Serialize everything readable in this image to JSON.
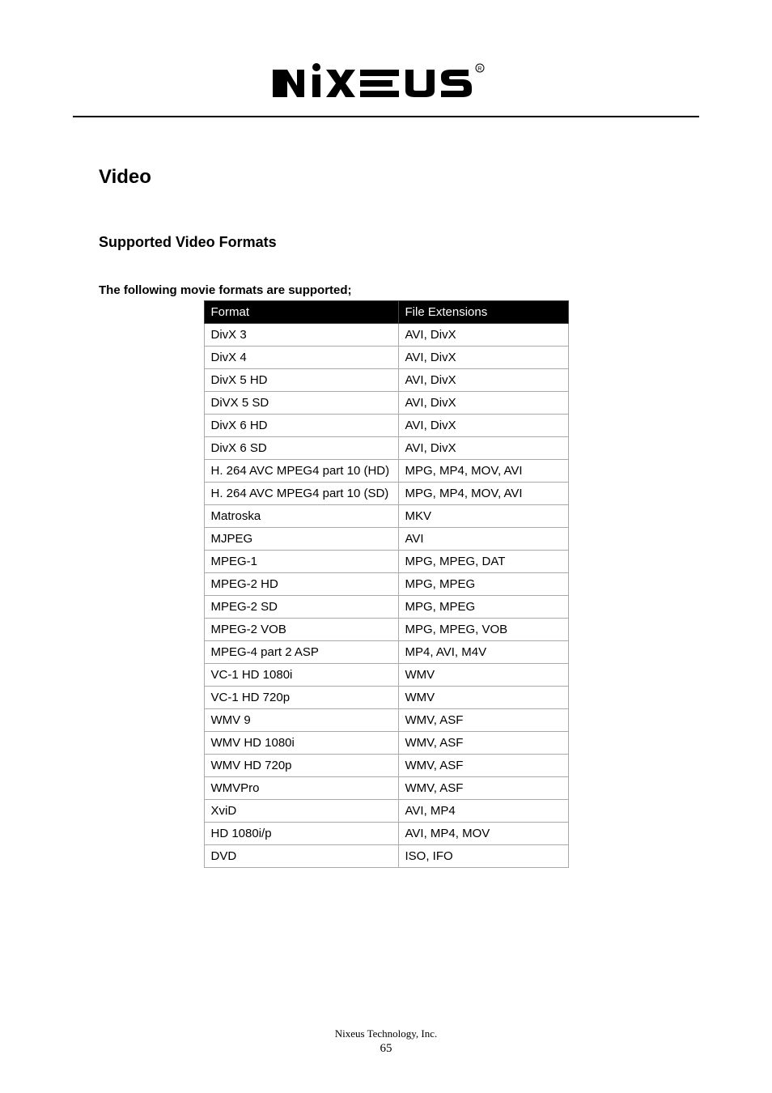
{
  "logo": {
    "text": "nixeus",
    "registered": "®"
  },
  "section_title": "Video",
  "subsection_title": "Supported Video Formats",
  "intro_text": "The following movie formats are supported;",
  "table": {
    "headers": [
      "Format",
      "File Extensions"
    ],
    "rows": [
      [
        "DivX 3",
        "AVI, DivX"
      ],
      [
        "DivX 4",
        "AVI, DivX"
      ],
      [
        "DivX 5 HD",
        "AVI, DivX"
      ],
      [
        "DiVX 5 SD",
        "AVI, DivX"
      ],
      [
        "DivX 6 HD",
        "AVI, DivX"
      ],
      [
        "DivX 6 SD",
        "AVI, DivX"
      ],
      [
        "H. 264 AVC MPEG4 part 10 (HD)",
        "MPG, MP4, MOV, AVI"
      ],
      [
        "H. 264 AVC MPEG4 part 10 (SD)",
        "MPG, MP4, MOV, AVI"
      ],
      [
        "Matroska",
        "MKV"
      ],
      [
        "MJPEG",
        "AVI"
      ],
      [
        "MPEG-1",
        "MPG, MPEG, DAT"
      ],
      [
        "MPEG-2 HD",
        "MPG, MPEG"
      ],
      [
        "MPEG-2 SD",
        "MPG, MPEG"
      ],
      [
        "MPEG-2 VOB",
        "MPG, MPEG, VOB"
      ],
      [
        "MPEG-4 part 2 ASP",
        "MP4, AVI, M4V"
      ],
      [
        "VC-1 HD 1080i",
        "WMV"
      ],
      [
        "VC-1 HD 720p",
        "WMV"
      ],
      [
        "WMV 9",
        "WMV, ASF"
      ],
      [
        "WMV HD 1080i",
        "WMV, ASF"
      ],
      [
        "WMV HD 720p",
        "WMV, ASF"
      ],
      [
        "WMVPro",
        "WMV, ASF"
      ],
      [
        "XviD",
        "AVI, MP4"
      ],
      [
        "HD 1080i/p",
        "AVI, MP4, MOV"
      ],
      [
        "DVD",
        "ISO, IFO"
      ]
    ]
  },
  "footer": {
    "company": "Nixeus Technology, Inc.",
    "page": "65"
  }
}
